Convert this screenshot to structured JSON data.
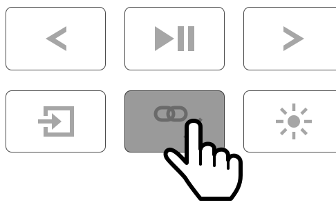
{
  "remote": {
    "buttons": [
      {
        "id": "previous",
        "icon": "chevron-left-icon",
        "pressed": false
      },
      {
        "id": "play-pause",
        "icon": "play-pause-icon",
        "pressed": false
      },
      {
        "id": "next",
        "icon": "chevron-right-icon",
        "pressed": false
      },
      {
        "id": "input-source",
        "icon": "input-source-icon",
        "pressed": false
      },
      {
        "id": "link-unlink",
        "icon": "link-unlink-icon",
        "pressed": true
      },
      {
        "id": "brightness",
        "icon": "brightness-icon",
        "pressed": false
      }
    ]
  },
  "overlay": {
    "icon": "pointing-hand-icon"
  },
  "colors": {
    "icon_gray": "#a6a6a6",
    "border": "#4a4a4a",
    "pressed_bg": "#9a9a9a",
    "background": "#ffffff"
  }
}
